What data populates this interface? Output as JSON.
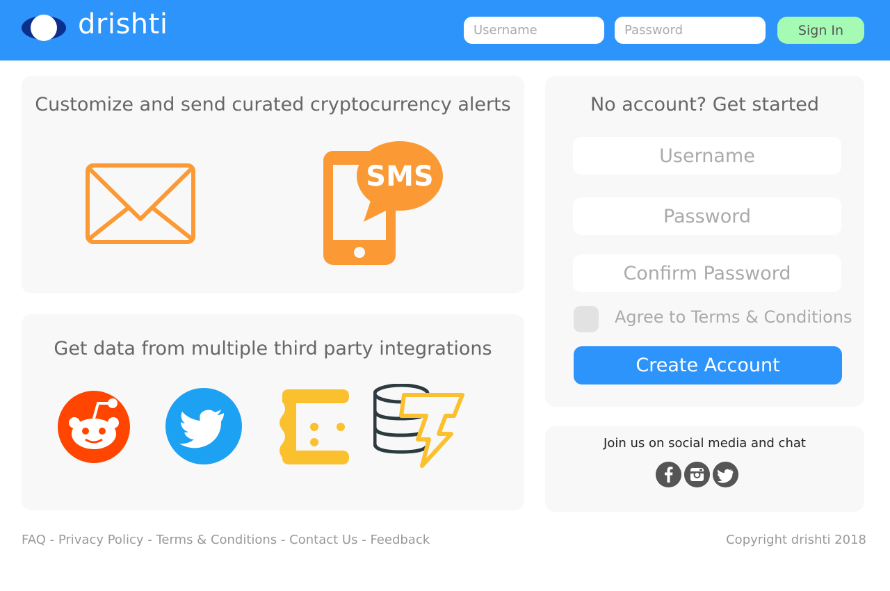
{
  "header": {
    "brand": "drishti",
    "username_placeholder": "Username",
    "password_placeholder": "Password",
    "signin_label": "Sign In"
  },
  "alerts": {
    "title": "Customize and send curated cryptocurrency alerts",
    "email_icon": "envelope-icon",
    "sms_icon": "phone-sms-icon",
    "sms_text": "SMS"
  },
  "integrations": {
    "title": "Get data from multiple third party integrations",
    "icons": [
      "reddit-icon",
      "twitter-icon",
      "cryptocompare-icon",
      "coin-thunder-icon"
    ]
  },
  "signup": {
    "title": "No account? Get started",
    "username_placeholder": "Username",
    "password_placeholder": "Password",
    "confirm_placeholder": "Confirm Password",
    "agree_label": "Agree to Terms & Conditions",
    "create_label": "Create Account"
  },
  "social": {
    "title": "Join us on social media and chat",
    "icons": [
      "facebook-icon",
      "instagram-icon",
      "twitter-icon"
    ]
  },
  "footer": {
    "links": [
      "FAQ",
      "Privacy Policy",
      "Terms & Conditions",
      "Contact Us",
      "Feedback"
    ],
    "separator": " - ",
    "copyright": "Copyright drishti 2018"
  },
  "colors": {
    "brand_blue": "#2d94fb",
    "signin_green": "#a5fbb3",
    "alert_orange": "#fb9a34",
    "reddit_red": "#ff4500",
    "twitter_blue": "#1da1f2",
    "yellow": "#fbc02d"
  }
}
